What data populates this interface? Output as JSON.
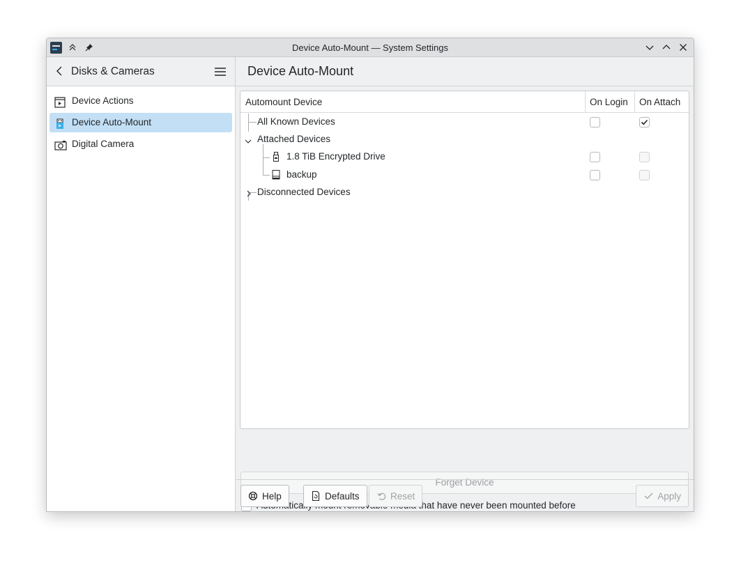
{
  "window": {
    "title": "Device Auto-Mount — System Settings"
  },
  "sidebar": {
    "title": "Disks & Cameras",
    "items": [
      {
        "label": "Device Actions",
        "icon": "device-actions-icon",
        "active": false
      },
      {
        "label": "Device Auto-Mount",
        "icon": "usb-drive-icon",
        "active": true
      },
      {
        "label": "Digital Camera",
        "icon": "camera-icon",
        "active": false
      }
    ]
  },
  "main": {
    "title": "Device Auto-Mount",
    "columns": [
      "Automount Device",
      "On Login",
      "On Attach"
    ],
    "rows": [
      {
        "label": "All Known Devices",
        "on_login": false,
        "on_attach": true
      },
      {
        "label": "Attached Devices",
        "expanded": true
      },
      {
        "label": "1.8 TiB Encrypted Drive",
        "icon": "usb-stick-icon",
        "on_login": false,
        "on_attach": false
      },
      {
        "label": "backup",
        "icon": "hard-drive-icon",
        "on_login": false,
        "on_attach": false
      },
      {
        "label": "Disconnected Devices",
        "expanded": false
      }
    ],
    "forget_button": "Forget Device",
    "auto_mount_new_label": "Automatically mount removable media that have never been mounted before",
    "auto_mount_new_checked": false
  },
  "buttons": {
    "help": "Help",
    "defaults": "Defaults",
    "reset": "Reset",
    "apply": "Apply"
  },
  "colors": {
    "accent": "#3daee9",
    "selection": "#c2dff5",
    "window_bg": "#eff0f1"
  }
}
